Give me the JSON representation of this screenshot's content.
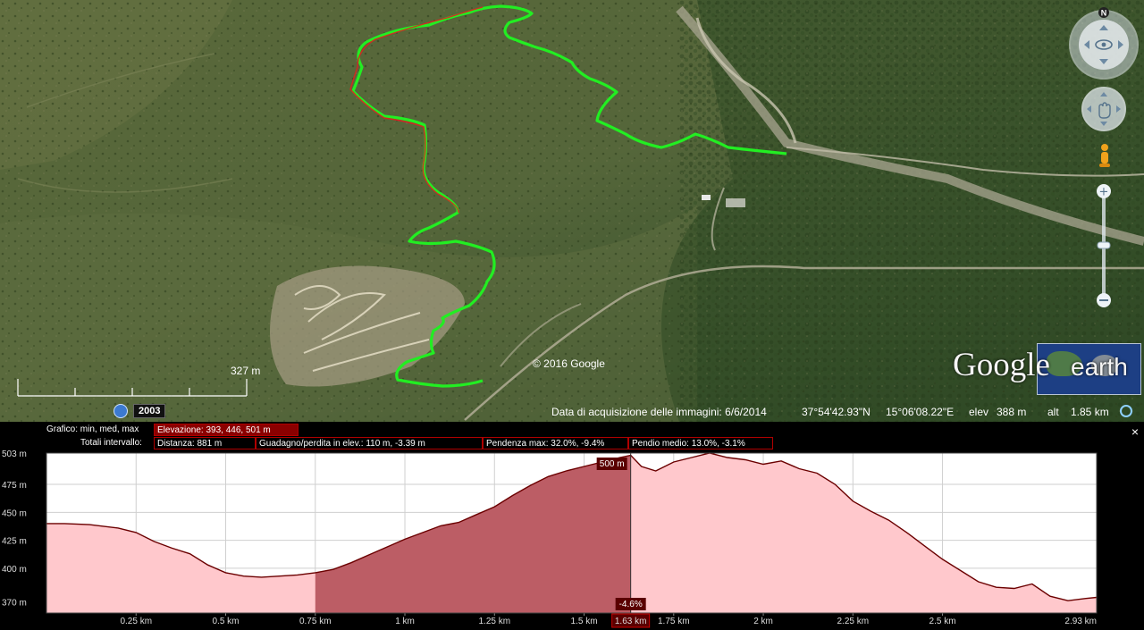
{
  "map": {
    "scale_label": "327 m",
    "copyright": "© 2016 Google",
    "history_year": "2003",
    "status": {
      "imagery_date": "Data di acquisizione delle immagini: 6/6/2014",
      "lat": "37°54'42.93\"N",
      "lon": "15°06'08.22\"E",
      "elev_label": "elev",
      "elev_value": "388 m",
      "alt_label": "alt",
      "alt_value": "1.85 km"
    },
    "logo": {
      "google": "Google",
      "earth": "earth"
    },
    "compass_letter": "N",
    "colors": {
      "track_green": "#22ee22",
      "track_red": "#e02020"
    }
  },
  "profile": {
    "close_icon": "×",
    "graph_label": "Grafico: min, med, max",
    "elevation": "Elevazione: 393, 446, 501 m",
    "totals_label": "Totali intervallo:",
    "distance": "Distanza: 881 m",
    "gain_loss": "Guadagno/perdita in elev.: 110 m, -3.39 m",
    "max_slope": "Pendenza max: 32.0%, -9.4%",
    "avg_slope": "Pendio medio: 13.0%, -3.1%",
    "cursor_elev": "500 m",
    "cursor_slope": "-4.6%",
    "cursor_dist": "1.63 km",
    "colors": {
      "line": "#6b0000",
      "fill": "#ffc8cc",
      "selection": "#b04a52"
    }
  },
  "chart_data": {
    "type": "area",
    "x_unit": "km",
    "y_unit": "m",
    "xlim": [
      0,
      2.93
    ],
    "ylim": [
      360,
      503
    ],
    "y_ticks": [
      {
        "value": 503,
        "label": "503 m"
      },
      {
        "value": 475,
        "label": "475 m"
      },
      {
        "value": 450,
        "label": "450 m"
      },
      {
        "value": 425,
        "label": "425 m"
      },
      {
        "value": 400,
        "label": "400 m"
      },
      {
        "value": 370,
        "label": "370 m"
      }
    ],
    "x_ticks": [
      {
        "value": 0.25,
        "label": "0.25 km"
      },
      {
        "value": 0.5,
        "label": "0.5 km"
      },
      {
        "value": 0.75,
        "label": "0.75 km"
      },
      {
        "value": 1.0,
        "label": "1 km"
      },
      {
        "value": 1.25,
        "label": "1.25 km"
      },
      {
        "value": 1.5,
        "label": "1.5 km"
      },
      {
        "value": 1.63,
        "label": "1.63 km"
      },
      {
        "value": 1.75,
        "label": "1.75 km"
      },
      {
        "value": 2.0,
        "label": "2 km"
      },
      {
        "value": 2.25,
        "label": "2.25 km"
      },
      {
        "value": 2.5,
        "label": "2.5 km"
      },
      {
        "value": 2.93,
        "label": "2.93 km"
      }
    ],
    "selection": [
      0.75,
      1.63
    ],
    "cursor_x": 1.63,
    "x": [
      0,
      0.05,
      0.12,
      0.2,
      0.25,
      0.3,
      0.35,
      0.4,
      0.45,
      0.5,
      0.55,
      0.6,
      0.65,
      0.7,
      0.75,
      0.8,
      0.85,
      0.9,
      0.95,
      1.0,
      1.05,
      1.1,
      1.15,
      1.2,
      1.25,
      1.3,
      1.35,
      1.4,
      1.45,
      1.5,
      1.55,
      1.6,
      1.63,
      1.66,
      1.7,
      1.75,
      1.8,
      1.85,
      1.9,
      1.95,
      2.0,
      2.05,
      2.1,
      2.15,
      2.2,
      2.25,
      2.3,
      2.35,
      2.4,
      2.45,
      2.5,
      2.55,
      2.6,
      2.65,
      2.7,
      2.75,
      2.8,
      2.85,
      2.9,
      2.93
    ],
    "y": [
      440,
      440,
      439,
      436,
      432,
      424,
      418,
      413,
      403,
      396,
      393,
      392,
      393,
      394,
      396,
      399,
      405,
      412,
      419,
      426,
      432,
      438,
      441,
      448,
      455,
      465,
      474,
      482,
      487,
      491,
      495,
      499,
      501,
      491,
      487,
      495,
      499,
      503,
      499,
      497,
      493,
      496,
      489,
      485,
      475,
      460,
      451,
      443,
      432,
      420,
      408,
      398,
      388,
      383,
      382,
      386,
      375,
      371,
      373,
      374
    ]
  }
}
